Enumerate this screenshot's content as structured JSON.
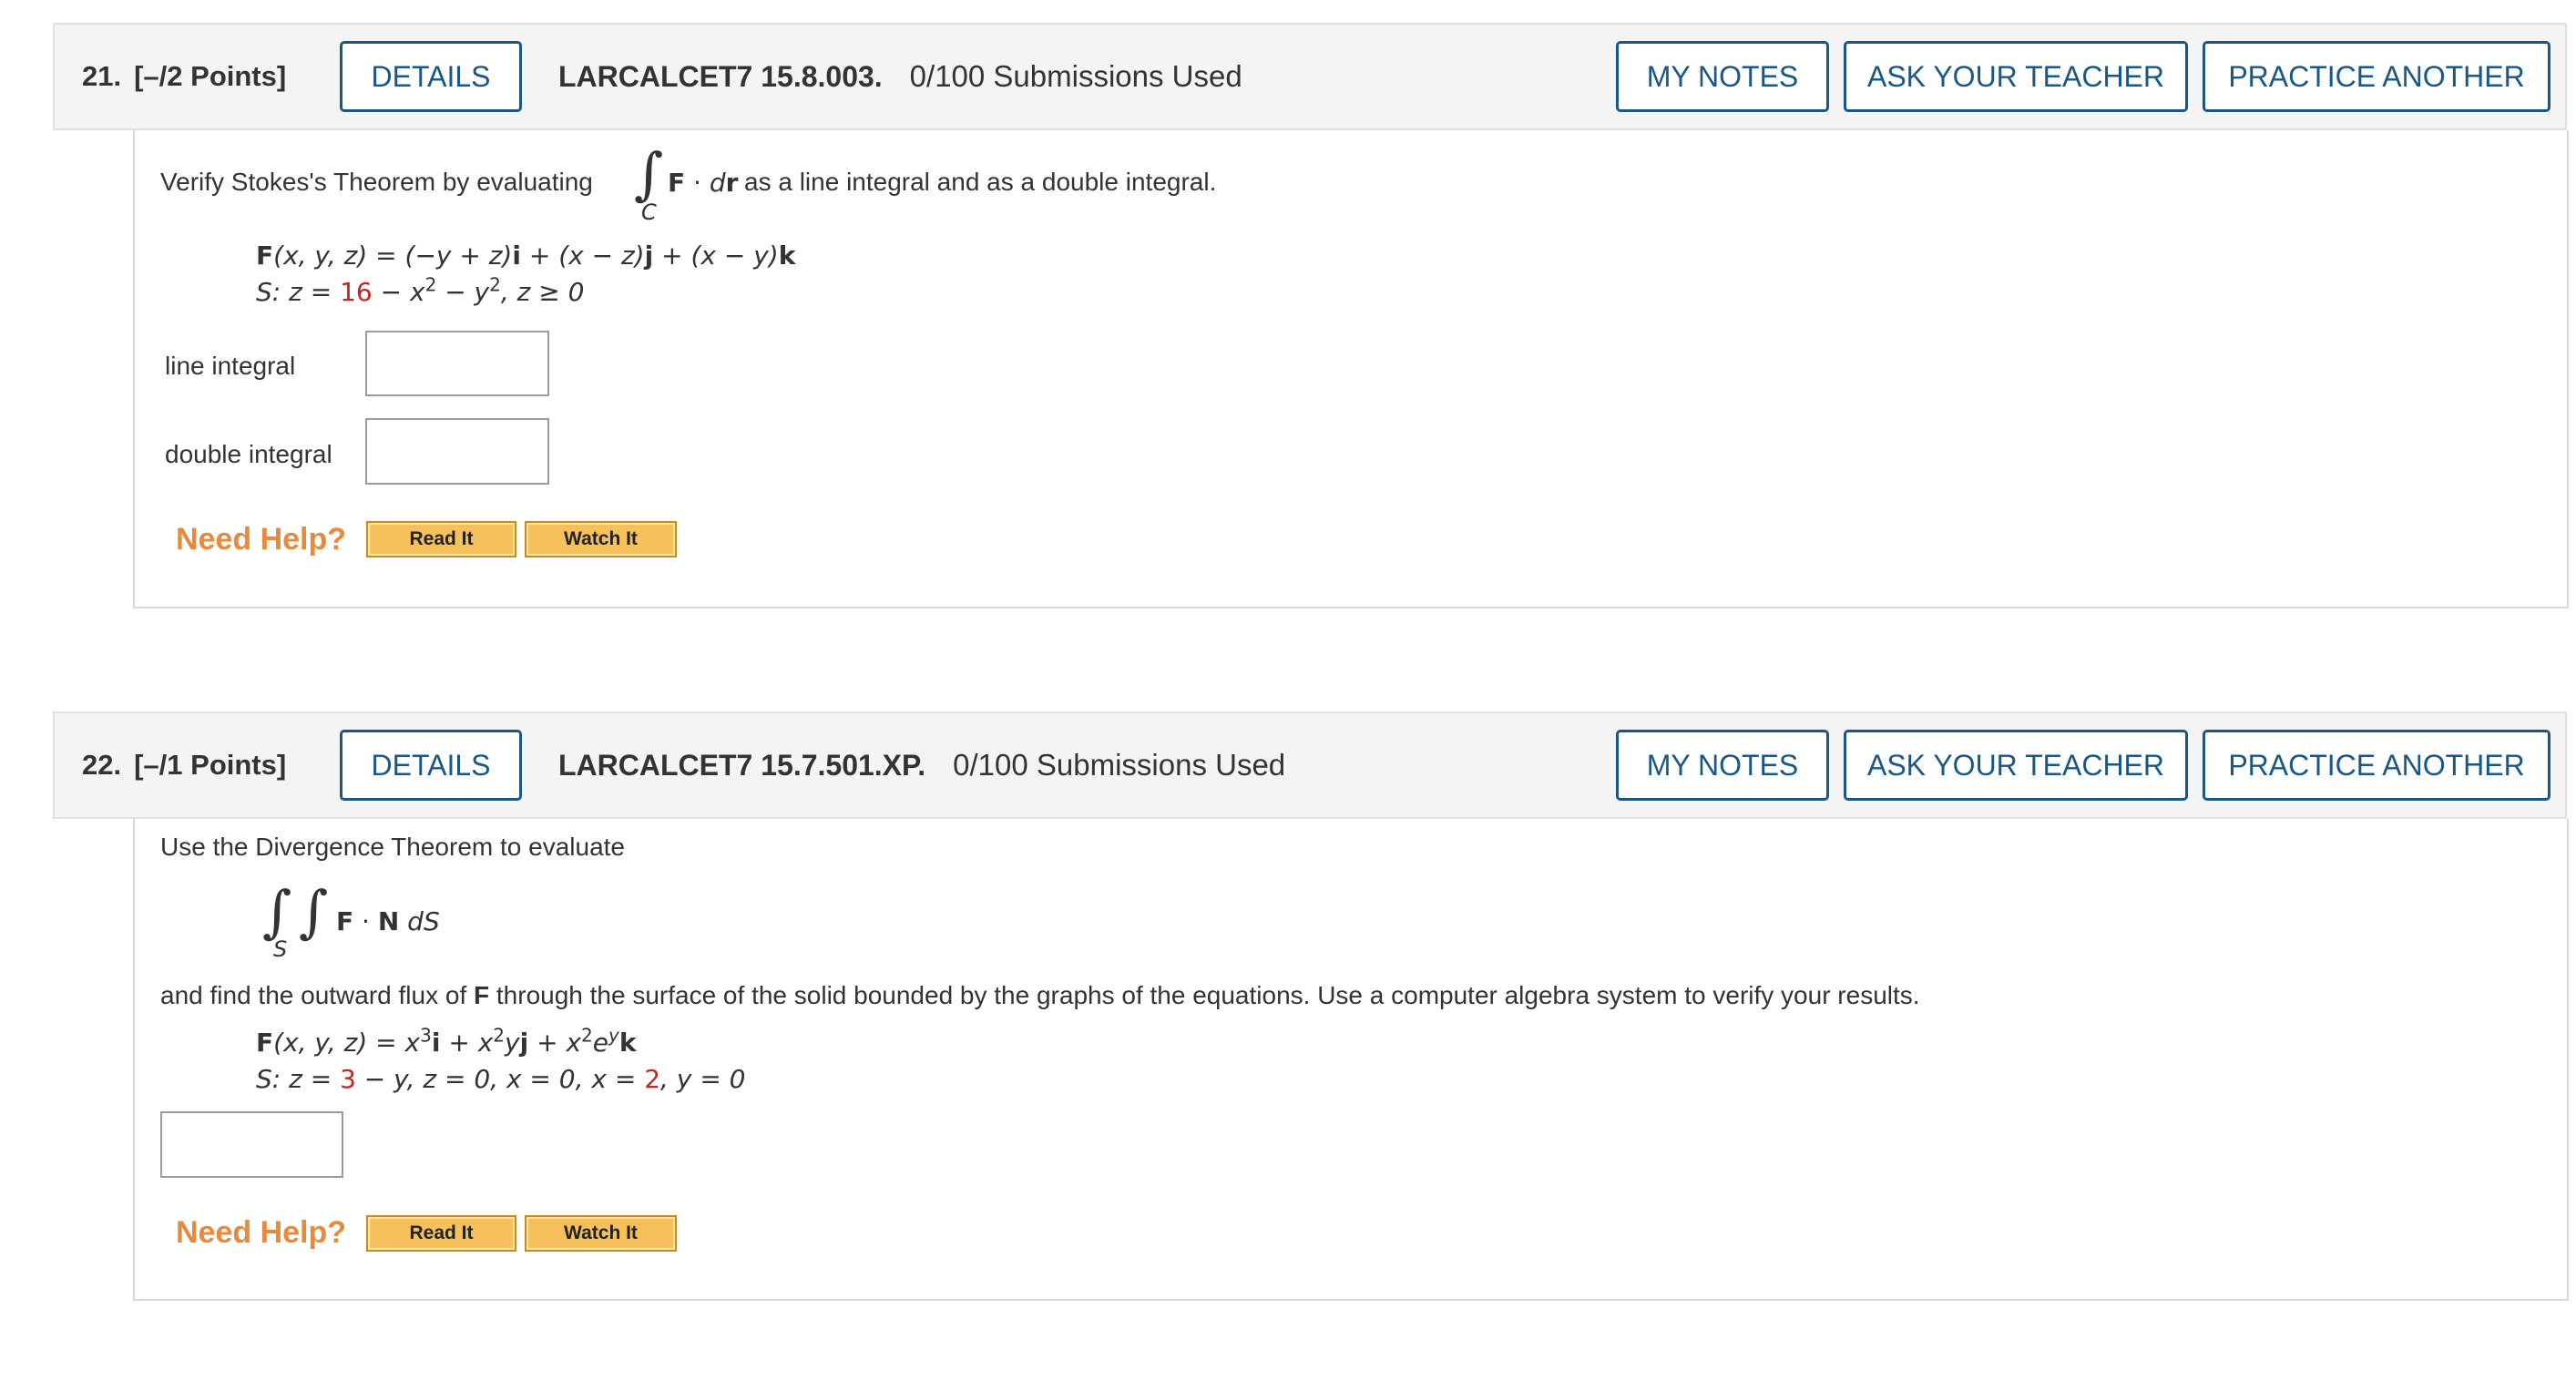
{
  "questions": [
    {
      "number": "21.",
      "points": "[–/2 Points]",
      "details_label": "DETAILS",
      "reference": "LARCALCET7 15.8.003.",
      "submissions": "0/100 Submissions Used",
      "my_notes_label": "MY NOTES",
      "ask_teacher_label": "ASK YOUR TEACHER",
      "practice_label": "PRACTICE ANOTHER",
      "prompt_before": "Verify Stokes's Theorem by evaluating",
      "integral_symbol": "∫",
      "integral_sub": "C",
      "integrand_F": "F",
      "integrand_dot": " · ",
      "integrand_d": "d",
      "integrand_r": "r",
      "prompt_after": "as a line integral and as a double integral.",
      "eq1": {
        "F": "F",
        "args": "(x, y, z) = (−y + z)",
        "i": "i",
        "mid1": " + (x − z)",
        "j": "j",
        "mid2": " + (x − y)",
        "k": "k"
      },
      "eq2": {
        "prefix": "S: z = ",
        "red_value": "16",
        "rest1": " − x",
        "exp1": "2",
        "rest2": " − y",
        "exp2": "2",
        "rest3": ",   z ≥ 0"
      },
      "answers": [
        {
          "label": "line integral",
          "value": ""
        },
        {
          "label": "double integral",
          "value": ""
        }
      ],
      "need_help": "Need Help?",
      "read_it": "Read It",
      "watch_it": "Watch It"
    },
    {
      "number": "22.",
      "points": "[–/1 Points]",
      "details_label": "DETAILS",
      "reference": "LARCALCET7 15.7.501.XP.",
      "submissions": "0/100 Submissions Used",
      "my_notes_label": "MY NOTES",
      "ask_teacher_label": "ASK YOUR TEACHER",
      "practice_label": "PRACTICE ANOTHER",
      "prompt": "Use the Divergence Theorem to evaluate",
      "integral_symbol": "∫",
      "integral_sub": "S",
      "integrand_F": "F",
      "integrand_dot": " · ",
      "integrand_N": "N",
      "integrand_dS": " dS",
      "find_text_before": "and find the outward flux of ",
      "find_F": "F",
      "find_text_after": " through the surface of the solid bounded by the graphs of the equations. Use a computer algebra system to verify your results.",
      "eq1": {
        "F": "F",
        "args": "(x, y, z) = x",
        "exp1": "3",
        "i": "i",
        "plus1": " + x",
        "exp2": "2",
        "y": "y",
        "j": "j",
        "plus2": " + x",
        "exp3": "2",
        "e": "e",
        "expy": "y",
        "k": "k"
      },
      "eq2": {
        "prefix": "S: z = ",
        "red1": "3",
        "mid": " − y, z = 0, x = 0, x = ",
        "red2": "2",
        "tail": ", y = 0"
      },
      "answer_value": "",
      "need_help": "Need Help?",
      "read_it": "Read It",
      "watch_it": "Watch It"
    }
  ],
  "colors": {
    "header_bg": "#f4f4f4",
    "button_blue": "#1a5785",
    "need_help_orange": "#e8893b",
    "help_button_bg": "#f6c05a",
    "red_value": "#c8241f"
  }
}
